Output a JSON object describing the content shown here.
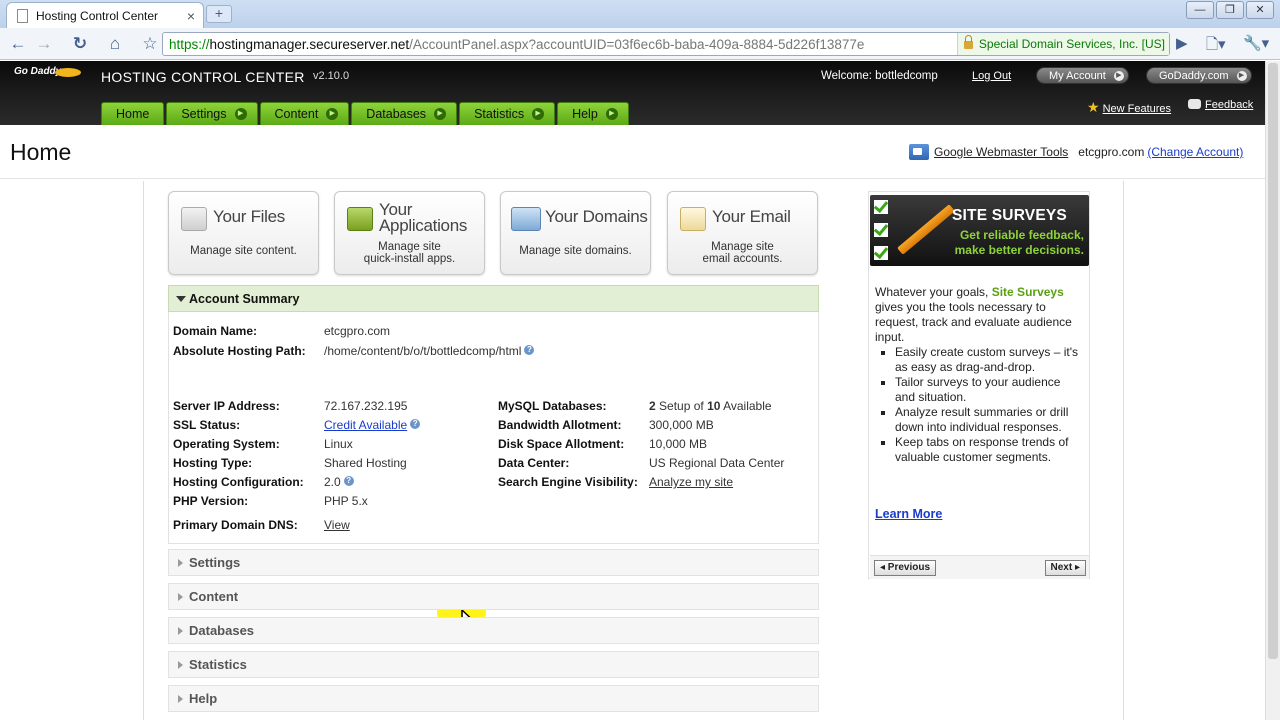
{
  "browser": {
    "tab_title": "Hosting Control Center",
    "tab_close": "×",
    "new_tab": "+",
    "window_controls": [
      "—",
      "❐",
      "✕"
    ],
    "url_scheme": "https://",
    "url_host": "hostingmanager.secureserver.net",
    "url_path": "/AccountPanel.aspx?accountUID=03f6ec6b-baba-409a-8884-5d226f13877e",
    "ev_cert": "Special Domain Services, Inc. [US]",
    "icons": [
      "back-icon",
      "forward-icon",
      "reload-icon",
      "home-icon",
      "star-icon",
      "lock-icon",
      "go-icon",
      "page-menu-icon",
      "wrench-icon"
    ]
  },
  "header": {
    "logo": "Go Daddy",
    "product": "HOSTING CONTROL CENTER",
    "version": "v2.10.0",
    "welcome": "Welcome: bottledcomp",
    "logout": "Log Out",
    "my_account": "My Account",
    "godaddy": "GoDaddy.com",
    "new_features": "New Features",
    "feedback": "Feedback",
    "nav": [
      {
        "label": "Home",
        "has_arrow": false
      },
      {
        "label": "Settings",
        "has_arrow": true
      },
      {
        "label": "Content",
        "has_arrow": true
      },
      {
        "label": "Databases",
        "has_arrow": true
      },
      {
        "label": "Statistics",
        "has_arrow": true
      },
      {
        "label": "Help",
        "has_arrow": true
      }
    ]
  },
  "page": {
    "title": "Home",
    "webmaster_tools": "Google Webmaster Tools",
    "account_domain": "etcgpro.com",
    "change_account": "(Change Account)"
  },
  "quick_links": [
    {
      "title1": "Your Files",
      "title2": "",
      "desc1": "Manage site content.",
      "desc2": ""
    },
    {
      "title1": "Your",
      "title2": "Applications",
      "desc1": "Manage site",
      "desc2": "quick-install apps."
    },
    {
      "title1": "Your Domains",
      "title2": "",
      "desc1": "Manage site domains.",
      "desc2": ""
    },
    {
      "title1": "Your Email",
      "title2": "",
      "desc1": "Manage site",
      "desc2": "email accounts."
    }
  ],
  "summary": {
    "heading": "Account Summary",
    "domain_label": "Domain Name:",
    "domain_value": "etcgpro.com",
    "path_label": "Absolute Hosting Path:",
    "path_value": "/home/content/b/o/t/bottledcomp/html",
    "ip_label": "Server IP Address:",
    "ip_value": "72.167.232.195",
    "ssl_label": "SSL Status:",
    "ssl_value": "Credit Available",
    "os_label": "Operating System:",
    "os_value": "Linux",
    "type_label": "Hosting Type:",
    "type_value": "Shared Hosting",
    "config_label": "Hosting Configuration:",
    "config_value": "2.0",
    "php_label": "PHP Version:",
    "php_value": "PHP 5.x",
    "dns_label": "Primary Domain DNS:",
    "dns_value": "View",
    "mysql_label": "MySQL Databases:",
    "mysql_used": "2",
    "mysql_mid": " Setup of ",
    "mysql_total": "10",
    "mysql_tail": " Available",
    "bandwidth_label": "Bandwidth Allotment:",
    "bandwidth_value": "300,000 MB",
    "disk_label": "Disk Space Allotment:",
    "disk_value": "10,000 MB",
    "datacenter_label": "Data Center:",
    "datacenter_value": "US Regional Data Center",
    "seo_label": "Search Engine Visibility:",
    "seo_value": "Analyze my site",
    "help_glyph": "?"
  },
  "sections": [
    "Settings",
    "Content",
    "Databases",
    "Statistics",
    "Help"
  ],
  "promo": {
    "banner_title": "SITE SURVEYS",
    "banner_line1": "Get reliable feedback,",
    "banner_line2": "make better decisions.",
    "intro_pre": "Whatever your goals, ",
    "intro_highlight": "Site Surveys",
    "intro_post": " gives you the tools necessary to request, track and evaluate audience input.",
    "bullets": [
      "Easily create custom surveys – it's as easy as drag-and-drop.",
      "Tailor surveys to your audience and situation.",
      "Analyze result summaries or drill down into individual responses.",
      "Keep tabs on response trends of valuable customer segments."
    ],
    "learn_more": "Learn More",
    "previous": "◂ Previous",
    "next": "Next ▸"
  },
  "colors": {
    "nav_green": "#6cbf22",
    "summary_bg": "#e3efd4",
    "link_blue": "#1a3ccc",
    "highlight_green": "#5a9f12"
  }
}
